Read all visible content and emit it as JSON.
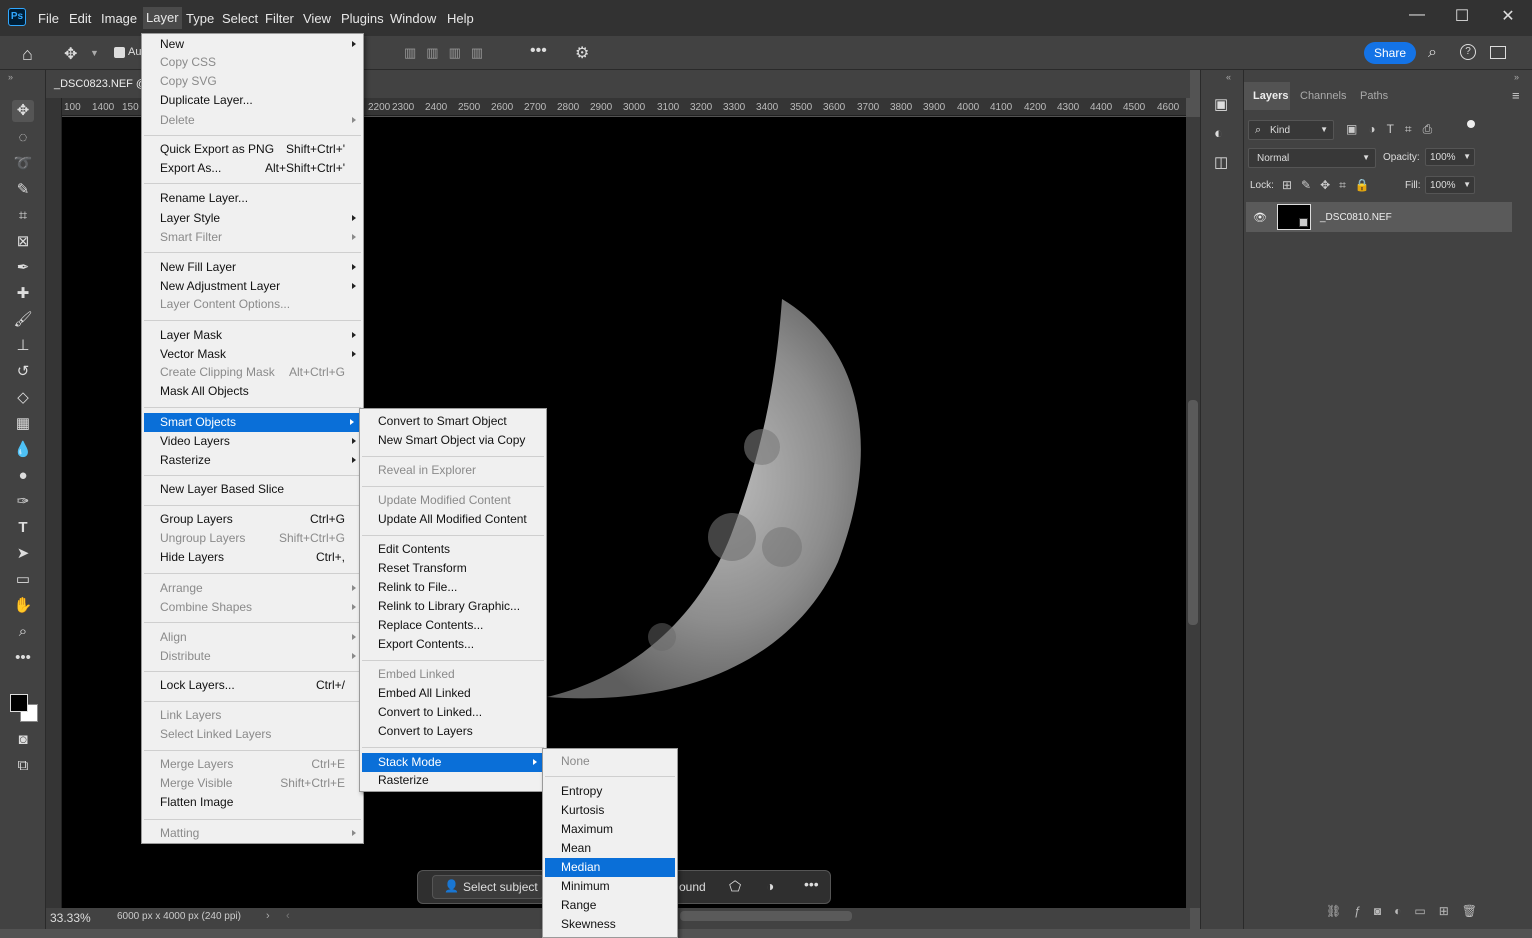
{
  "app": {
    "logo": "Ps"
  },
  "menubar": [
    "File",
    "Edit",
    "Image",
    "Layer",
    "Type",
    "Select",
    "Filter",
    "View",
    "Plugins",
    "Window",
    "Help"
  ],
  "window_controls": {
    "minimize": "—",
    "maximize": "☐",
    "close": "✕"
  },
  "options": {
    "auto_label": "Au",
    "share_label": "Share"
  },
  "document": {
    "tab_title": "_DSC0823.NEF @",
    "zoom": "33.33%",
    "info": "6000 px x 4000 px (240 ppi)"
  },
  "ruler_ticks": [
    "100",
    "1400",
    "150",
    "2200",
    "2300",
    "2400",
    "2500",
    "2600",
    "2700",
    "2800",
    "2900",
    "3000",
    "3100",
    "3200",
    "3300",
    "3400",
    "3500",
    "3600",
    "3700",
    "3800",
    "3900",
    "4000",
    "4100",
    "4200",
    "4300",
    "4400",
    "4500",
    "4600"
  ],
  "layer_menu": [
    {
      "label": "New",
      "arrow": true
    },
    {
      "label": "Copy CSS",
      "disabled": true
    },
    {
      "label": "Copy SVG",
      "disabled": true
    },
    {
      "label": "Duplicate Layer..."
    },
    {
      "label": "Delete",
      "disabled": true,
      "arrow": true
    },
    {
      "sep": true
    },
    {
      "label": "Quick Export as PNG",
      "shortcut": "Shift+Ctrl+'"
    },
    {
      "label": "Export As...",
      "shortcut": "Alt+Shift+Ctrl+'"
    },
    {
      "sep": true
    },
    {
      "label": "Rename Layer..."
    },
    {
      "label": "Layer Style",
      "arrow": true
    },
    {
      "label": "Smart Filter",
      "disabled": true,
      "arrow": true
    },
    {
      "sep": true
    },
    {
      "label": "New Fill Layer",
      "arrow": true
    },
    {
      "label": "New Adjustment Layer",
      "arrow": true
    },
    {
      "label": "Layer Content Options...",
      "disabled": true
    },
    {
      "sep": true
    },
    {
      "label": "Layer Mask",
      "arrow": true
    },
    {
      "label": "Vector Mask",
      "arrow": true
    },
    {
      "label": "Create Clipping Mask",
      "shortcut": "Alt+Ctrl+G",
      "disabled": true
    },
    {
      "label": "Mask All Objects"
    },
    {
      "sep": true
    },
    {
      "label": "Smart Objects",
      "arrow": true,
      "selected": true
    },
    {
      "label": "Video Layers",
      "arrow": true
    },
    {
      "label": "Rasterize",
      "arrow": true
    },
    {
      "sep": true
    },
    {
      "label": "New Layer Based Slice"
    },
    {
      "sep": true
    },
    {
      "label": "Group Layers",
      "shortcut": "Ctrl+G"
    },
    {
      "label": "Ungroup Layers",
      "shortcut": "Shift+Ctrl+G",
      "disabled": true
    },
    {
      "label": "Hide Layers",
      "shortcut": "Ctrl+,"
    },
    {
      "sep": true
    },
    {
      "label": "Arrange",
      "disabled": true,
      "arrow": true
    },
    {
      "label": "Combine Shapes",
      "disabled": true,
      "arrow": true
    },
    {
      "sep": true
    },
    {
      "label": "Align",
      "disabled": true,
      "arrow": true
    },
    {
      "label": "Distribute",
      "disabled": true,
      "arrow": true
    },
    {
      "sep": true
    },
    {
      "label": "Lock Layers...",
      "shortcut": "Ctrl+/"
    },
    {
      "sep": true
    },
    {
      "label": "Link Layers",
      "disabled": true
    },
    {
      "label": "Select Linked Layers",
      "disabled": true
    },
    {
      "sep": true
    },
    {
      "label": "Merge Layers",
      "shortcut": "Ctrl+E",
      "disabled": true
    },
    {
      "label": "Merge Visible",
      "shortcut": "Shift+Ctrl+E",
      "disabled": true
    },
    {
      "label": "Flatten Image"
    },
    {
      "sep": true
    },
    {
      "label": "Matting",
      "disabled": true,
      "arrow": true
    }
  ],
  "smart_objects_menu": [
    {
      "label": "Convert to Smart Object"
    },
    {
      "label": "New Smart Object via Copy"
    },
    {
      "sep": true
    },
    {
      "label": "Reveal in Explorer",
      "disabled": true
    },
    {
      "sep": true
    },
    {
      "label": "Update Modified Content",
      "disabled": true
    },
    {
      "label": "Update All Modified Content"
    },
    {
      "sep": true
    },
    {
      "label": "Edit Contents"
    },
    {
      "label": "Reset Transform"
    },
    {
      "label": "Relink to File..."
    },
    {
      "label": "Relink to Library Graphic..."
    },
    {
      "label": "Replace Contents..."
    },
    {
      "label": "Export Contents..."
    },
    {
      "sep": true
    },
    {
      "label": "Embed Linked",
      "disabled": true
    },
    {
      "label": "Embed All Linked"
    },
    {
      "label": "Convert to Linked..."
    },
    {
      "label": "Convert to Layers"
    },
    {
      "sep": true
    },
    {
      "label": "Stack Mode",
      "arrow": true,
      "selected": true
    },
    {
      "label": "Rasterize"
    }
  ],
  "stack_mode_menu": [
    {
      "label": "None",
      "disabled": true
    },
    {
      "sep": true
    },
    {
      "label": "Entropy"
    },
    {
      "label": "Kurtosis"
    },
    {
      "label": "Maximum"
    },
    {
      "label": "Mean"
    },
    {
      "label": "Median",
      "selected": true
    },
    {
      "label": "Minimum"
    },
    {
      "label": "Range"
    },
    {
      "label": "Skewness"
    }
  ],
  "panel": {
    "tabs": [
      "Layers",
      "Channels",
      "Paths"
    ],
    "filter_kind": "Kind",
    "blend_mode": "Normal",
    "opacity_label": "Opacity:",
    "opacity_value": "100%",
    "lock_label": "Lock:",
    "fill_label": "Fill:",
    "fill_value": "100%",
    "layer_name": "_DSC0810.NEF"
  },
  "taskbar": {
    "select_subject": "Select subject",
    "remove_bg": "ound"
  }
}
